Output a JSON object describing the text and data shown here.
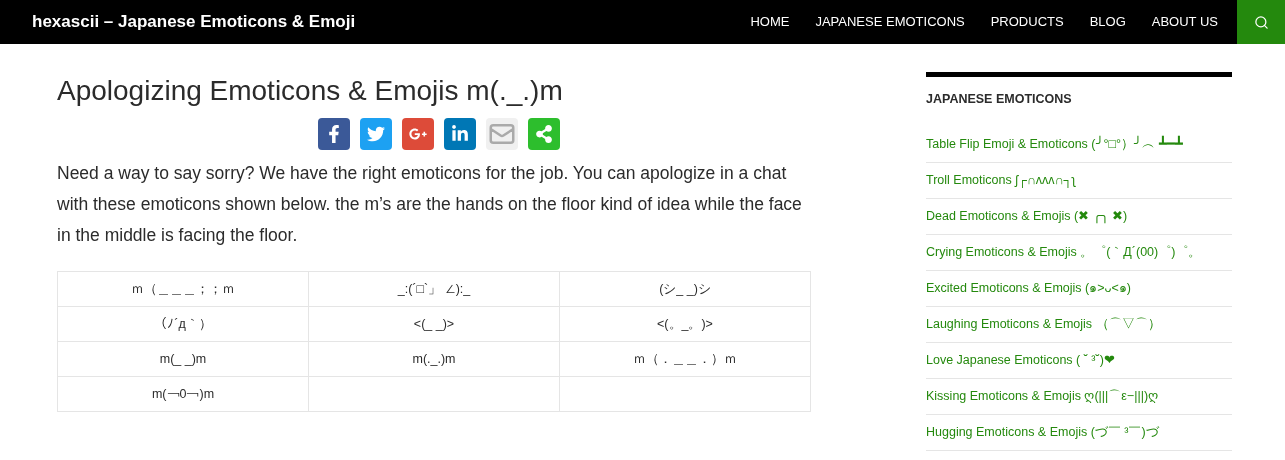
{
  "header": {
    "site_title": "hexascii – Japanese Emoticons & Emoji",
    "nav": [
      {
        "label": "HOME"
      },
      {
        "label": "JAPANESE EMOTICONS"
      },
      {
        "label": "PRODUCTS"
      },
      {
        "label": "BLOG"
      },
      {
        "label": "ABOUT US"
      }
    ]
  },
  "article": {
    "title": "Apologizing Emoticons & Emojis m(._.)m",
    "share": [
      {
        "kind": "facebook"
      },
      {
        "kind": "twitter"
      },
      {
        "kind": "googleplus"
      },
      {
        "kind": "linkedin"
      },
      {
        "kind": "email"
      },
      {
        "kind": "share"
      }
    ],
    "intro": "Need a way to say sorry? We have the right emoticons for the job. You can apologize in a chat with these emoticons shown below. the m’s are the hands on the floor kind of idea while the face in the middle is facing the floor.",
    "table": {
      "rows": [
        [
          "ｍ（＿＿＿；；ｍ",
          "_:(´□`」 ∠):_",
          "(シ_ _)シ"
        ],
        [
          "（ﾉ´д｀）",
          "<(_ _)>",
          "<(。_。)>"
        ],
        [
          "m(_ _)m",
          "m(._.)m",
          "ｍ（．＿＿．）ｍ"
        ],
        [
          "m(￢0￢)m",
          "",
          ""
        ]
      ]
    }
  },
  "sidebar": {
    "heading": "JAPANESE EMOTICONS",
    "links": [
      "Table Flip Emoji & Emoticons (╯°□°）╯︵ ┻━┻",
      "Troll Emoticons ʃ┌∩ʌʌʌ∩┐ʅ",
      "Dead Emoticons & Emojis (✖ ╭╮ ✖)",
      "Crying Emoticons & Emojis 。゜(｀Д´(00)゜)゜。",
      "Excited Emoticons & Emojis (๑>ᴗ<๑)",
      "Laughing Emoticons & Emojis （⌒▽⌒）",
      "Love Japanese Emoticons ( ˘ ³˘)❤",
      "Kissing Emoticons & Emojis ღ(|||⌒ε−|||)ღ",
      "Hugging Emoticons & Emojis (づ￣ ³￣)づ"
    ]
  }
}
